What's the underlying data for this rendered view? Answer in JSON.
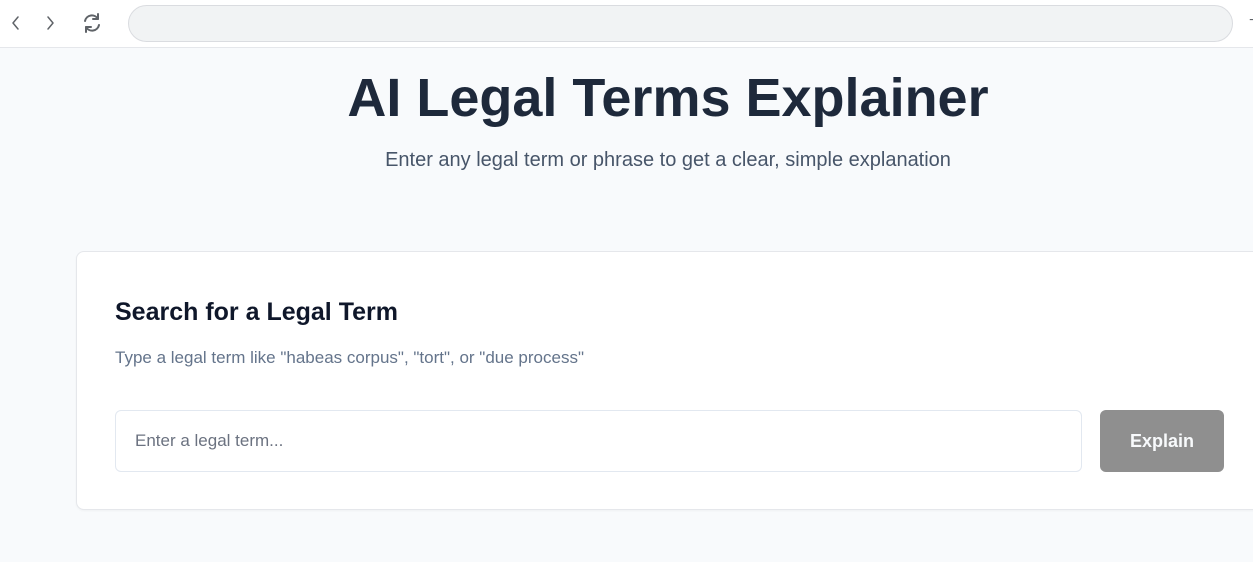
{
  "browser": {
    "back_icon": "chevron-left-icon",
    "forward_icon": "chevron-right-icon",
    "reload_icon": "refresh-icon",
    "address_value": "",
    "edge_glyph": "+"
  },
  "header": {
    "title": "AI Legal Terms Explainer",
    "subtitle": "Enter any legal term or phrase to get a clear, simple explanation"
  },
  "search_card": {
    "title": "Search for a Legal Term",
    "description": "Type a legal term like \"habeas corpus\", \"tort\", or \"due process\"",
    "input": {
      "value": "",
      "placeholder": "Enter a legal term..."
    },
    "button_label": "Explain"
  },
  "colors": {
    "page_background": "#f8fafc",
    "heading": "#1e293b",
    "subtitle": "#475569",
    "card_text": "#64748b",
    "button_disabled": "#8f8f8f"
  }
}
